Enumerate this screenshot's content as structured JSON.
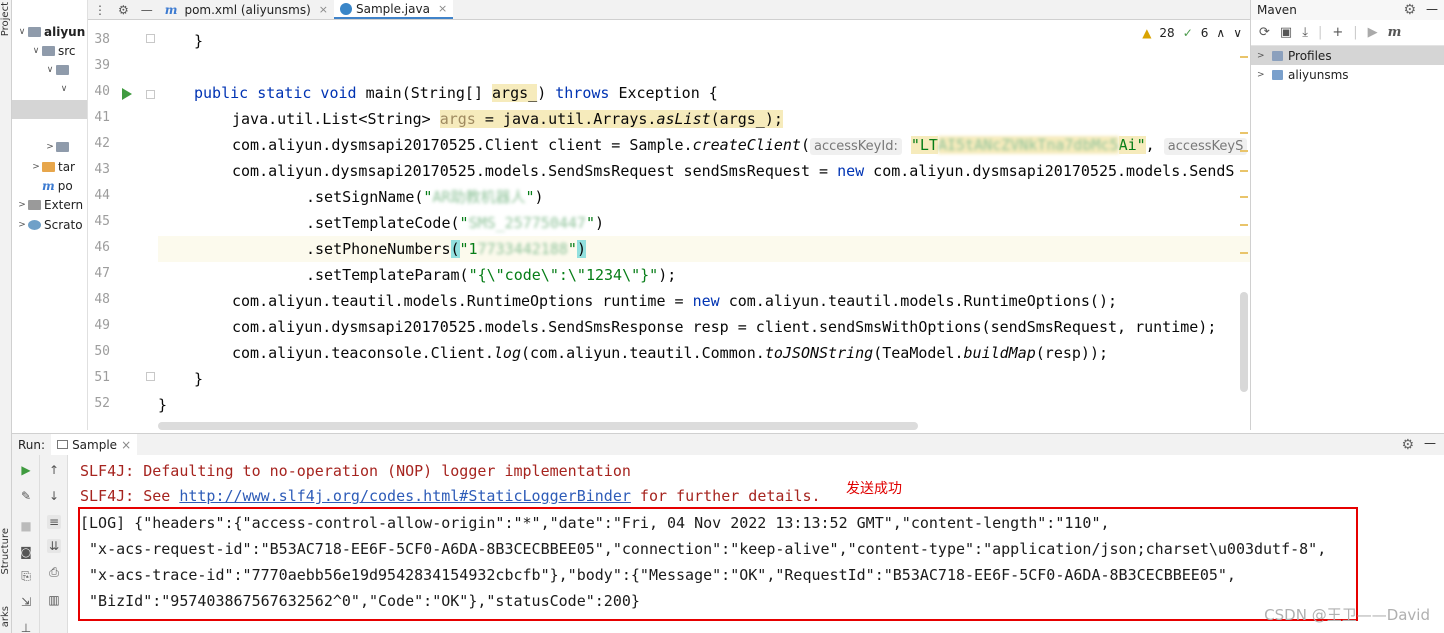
{
  "side_labels": {
    "project": "Project",
    "structure": "Structure",
    "bookmarks": "arks"
  },
  "project_tree": [
    {
      "label": "aliyun",
      "indent": 0,
      "arrow": "v",
      "bold": true,
      "icon": "folder"
    },
    {
      "label": "src",
      "indent": 1,
      "arrow": "v",
      "icon": "folder"
    },
    {
      "label": "",
      "indent": 2,
      "arrow": "v",
      "icon": "folder"
    },
    {
      "label": "",
      "indent": 3,
      "arrow": "v",
      "icon": ""
    },
    {
      "label": "",
      "indent": 3,
      "arrow": "",
      "icon": ""
    },
    {
      "label": "",
      "indent": 3,
      "arrow": "",
      "icon": ""
    },
    {
      "label": "",
      "indent": 2,
      "arrow": ">",
      "icon": "folder"
    },
    {
      "label": "tar",
      "indent": 1,
      "arrow": ">",
      "icon": "folder-orange"
    },
    {
      "label": "po",
      "indent": 1,
      "arrow": "",
      "icon": "maven"
    },
    {
      "label": "Extern",
      "indent": 0,
      "arrow": ">",
      "icon": "library"
    },
    {
      "label": "Scrato",
      "indent": 0,
      "arrow": ">",
      "icon": "scratch"
    }
  ],
  "tabs": [
    {
      "label": "pom.xml (aliyunsms)",
      "icon": "m",
      "active": false
    },
    {
      "label": "Sample.java",
      "icon": "c",
      "active": true
    }
  ],
  "inspections": {
    "warnings": "28",
    "ok": "6"
  },
  "gutter_lines": [
    "38",
    "39",
    "40",
    "41",
    "42",
    "43",
    "44",
    "45",
    "46",
    "47",
    "48",
    "49",
    "50",
    "51",
    "52"
  ],
  "code": {
    "l38": "}",
    "l40_kw1": "public static void",
    "l40_main": "main",
    "l40_a": "(String[] ",
    "l40_arg": "args_",
    "l40_b": ") ",
    "l40_throws": "throws",
    "l40_c": " Exception {",
    "l41_a": "java.util.List<String> ",
    "l41_args": "args",
    "l41_b": " = java.util.Arrays.",
    "l41_aslist": "asList",
    "l41_c": "(args_);",
    "l42_a": "com.aliyun.dysmsapi20170525.Client client = Sample.",
    "l42_create": "createClient",
    "l42_b": "(",
    "l42_hint1": "accessKeyId:",
    "l42_q1": "\"LT",
    "l42_masked": "AI5tANcZVNkTna7dbMc5",
    "l42_q2": "Ai\"",
    "l42_c": ", ",
    "l42_hint2": "accessKeyS",
    "l43_a": "com.aliyun.dysmsapi20170525.models.SendSmsRequest sendSmsRequest = ",
    "l43_new": "new",
    "l43_b": " com.aliyun.dysmsapi20170525.models.SendS",
    "l44_a": ".setSignName(",
    "l44_q1": "\"",
    "l44_str": "AR助教机器人",
    "l44_q2": "\"",
    "l44_b": ")",
    "l45_a": ".setTemplateCode(",
    "l45_q1": "\"",
    "l45_masked": "SMS_257750447",
    "l45_q2": "\"",
    "l45_b": ")",
    "l46_a": ".setPhoneNumbers",
    "l46_p1": "(",
    "l46_q1": "\"1",
    "l46_masked": "7733442188",
    "l46_q2": "\"",
    "l46_p2": ")",
    "l47_a": ".setTemplateParam(",
    "l47_str": "\"{\\\"code\\\":\\\"1234\\\"}\"",
    "l47_b": ");",
    "l48_a": "com.aliyun.teautil.models.RuntimeOptions runtime = ",
    "l48_new": "new",
    "l48_b": " com.aliyun.teautil.models.RuntimeOptions();",
    "l49": "com.aliyun.dysmsapi20170525.models.SendSmsResponse resp = client.sendSmsWithOptions(sendSmsRequest, runtime);",
    "l50_a": "com.aliyun.teaconsole.Client.",
    "l50_log": "log",
    "l50_b": "(com.aliyun.teautil.Common.",
    "l50_json": "toJSONString",
    "l50_c": "(TeaModel.",
    "l50_build": "buildMap",
    "l50_d": "(resp));",
    "l51": "}",
    "l52": "}"
  },
  "maven": {
    "title": "Maven",
    "items": [
      {
        "label": "Profiles",
        "selected": true
      },
      {
        "label": "aliyunsms",
        "selected": false
      }
    ]
  },
  "run": {
    "label": "Run:",
    "tab": "Sample",
    "console": {
      "line1": "SLF4J: Defaulting to no-operation (NOP) logger implementation",
      "line2_a": "SLF4J: See ",
      "line2_link": "http://www.slf4j.org/codes.html#StaticLoggerBinder",
      "line2_b": " for further details.",
      "log1": "[LOG] {\"headers\":{\"access-control-allow-origin\":\"*\",\"date\":\"Fri, 04 Nov 2022 13:13:52 GMT\",\"content-length\":\"110\",",
      "log2": " \"x-acs-request-id\":\"B53AC718-EE6F-5CF0-A6DA-8B3CECBBEE05\",\"connection\":\"keep-alive\",\"content-type\":\"application/json;charset\\u003dutf-8\",",
      "log3": " \"x-acs-trace-id\":\"7770aebb56e19d9542834154932cbcfb\"},\"body\":{\"Message\":\"OK\",\"RequestId\":\"B53AC718-EE6F-5CF0-A6DA-8B3CECBBEE05\",",
      "log4": " \"BizId\":\"957403867567632562^0\",\"Code\":\"OK\"},\"statusCode\":200}"
    },
    "annotation": "发送成功"
  },
  "watermark": "CSDN @王卫——David",
  "colors": {
    "accent": "#4083c9",
    "keyword": "#0033b3",
    "string": "#067d17",
    "annotation_red": "#e60000"
  }
}
